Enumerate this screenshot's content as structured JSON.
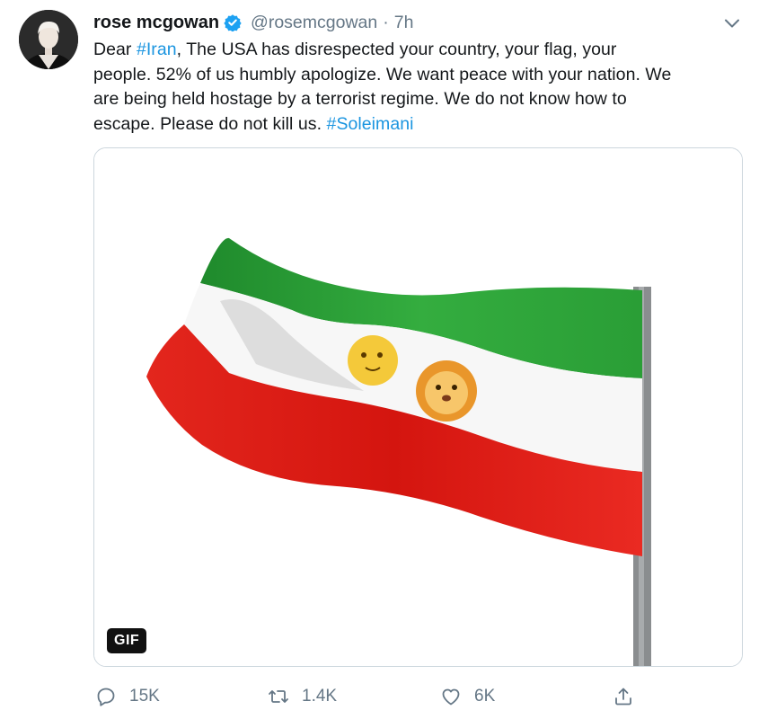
{
  "tweet": {
    "author": {
      "display_name": "rose mcgowan",
      "handle": "@rosemcgowan",
      "verified": true,
      "avatar_icon": "user-avatar"
    },
    "separator": "·",
    "time": "7h",
    "text_lines": [
      [
        {
          "text": "Dear ",
          "tag": false
        },
        {
          "text": "#Iran",
          "tag": true
        },
        {
          "text": ", The USA has disrespected your country, your flag, your",
          "tag": false
        }
      ],
      [
        {
          "text": "people. 52% of us humbly apologize. We want peace with your nation. We",
          "tag": false
        }
      ],
      [
        {
          "text": "are being held hostage by a terrorist regime. We do not know how to",
          "tag": false
        }
      ],
      [
        {
          "text": "escape. Please do not kill us. ",
          "tag": false
        },
        {
          "text": "#Soleimani",
          "tag": true
        }
      ]
    ],
    "media": {
      "badge": "GIF",
      "content": "waving-flag-gif"
    },
    "actions": {
      "reply": {
        "count": "15K",
        "icon": "reply-icon"
      },
      "retweet": {
        "count": "1.4K",
        "icon": "retweet-icon"
      },
      "like": {
        "count": "6K",
        "icon": "heart-icon"
      },
      "share": {
        "icon": "share-icon"
      }
    }
  },
  "colors": {
    "text": "#14171a",
    "secondary": "#657786",
    "link": "#1b95e0",
    "verified": "#1da1f2",
    "flag_green": "#2ea43a",
    "flag_red": "#e8231c"
  }
}
